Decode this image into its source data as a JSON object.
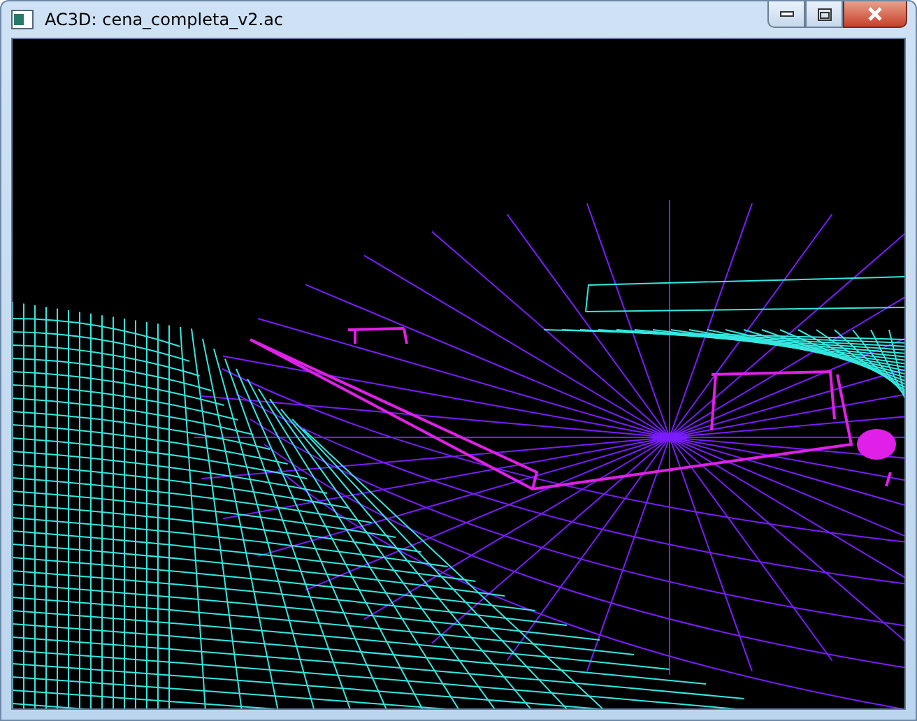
{
  "window": {
    "title": "AC3D: cena_completa_v2.ac"
  }
}
